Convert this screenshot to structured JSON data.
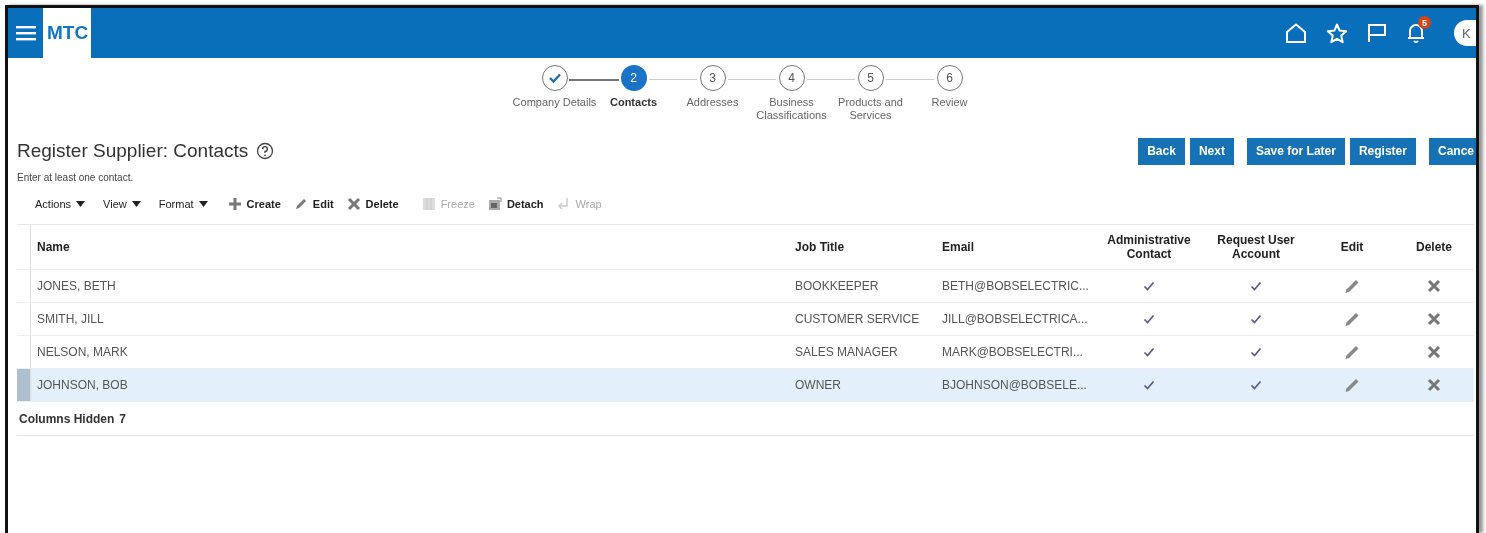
{
  "header": {
    "logo": "MTC",
    "notifications_badge": "5",
    "avatar": "K"
  },
  "train": [
    {
      "label": "Company Details",
      "completed": true,
      "selected": false
    },
    {
      "label": "Contacts",
      "number": "2",
      "completed": false,
      "selected": true
    },
    {
      "label": "Addresses",
      "number": "3",
      "completed": false,
      "selected": false
    },
    {
      "label": "Business Classifications",
      "number": "4",
      "completed": false,
      "selected": false
    },
    {
      "label": "Products and Services",
      "number": "5",
      "completed": false,
      "selected": false
    },
    {
      "label": "Review",
      "number": "6",
      "completed": false,
      "selected": false
    }
  ],
  "page_title": "Register Supplier: Contacts",
  "button_groups": [
    [
      "Back",
      "Next"
    ],
    [
      "Save for Later",
      "Register"
    ],
    [
      "Cance"
    ]
  ],
  "hint": "Enter at least one contact.",
  "toolbar": [
    {
      "label": "Actions",
      "kind": "menu",
      "disabled": false
    },
    {
      "label": "View",
      "kind": "menu",
      "disabled": false
    },
    {
      "label": "Format",
      "kind": "menu",
      "disabled": false
    },
    {
      "label": "Create",
      "kind": "create",
      "disabled": false
    },
    {
      "label": "Edit",
      "kind": "edit",
      "disabled": false
    },
    {
      "label": "Delete",
      "kind": "delete",
      "disabled": false
    },
    {
      "label": "Freeze",
      "kind": "freeze",
      "disabled": true
    },
    {
      "label": "Detach",
      "kind": "detach",
      "disabled": false
    },
    {
      "label": "Wrap",
      "kind": "wrap",
      "disabled": true
    }
  ],
  "table": {
    "columns": [
      "Name",
      "Job Title",
      "Email",
      "Administrative Contact",
      "Request User Account",
      "Edit",
      "Delete"
    ],
    "rows": [
      {
        "name": "JONES, BETH",
        "job_title": "BOOKKEEPER",
        "email": "BETH@BOBSELECTRIC...",
        "administrative_contact": true,
        "request_user_account": true,
        "selected": false
      },
      {
        "name": "SMITH, JILL",
        "job_title": "CUSTOMER SERVICE",
        "email": "JILL@BOBSELECTRICA...",
        "administrative_contact": true,
        "request_user_account": true,
        "selected": false
      },
      {
        "name": "NELSON, MARK",
        "job_title": "SALES MANAGER",
        "email": "MARK@BOBSELECTRI...",
        "administrative_contact": true,
        "request_user_account": true,
        "selected": false
      },
      {
        "name": "JOHNSON, BOB",
        "job_title": "OWNER",
        "email": "BJOHNSON@BOBSELE...",
        "administrative_contact": true,
        "request_user_account": true,
        "selected": true
      }
    ],
    "footer": {
      "label": "Columns Hidden",
      "count": "7"
    }
  }
}
